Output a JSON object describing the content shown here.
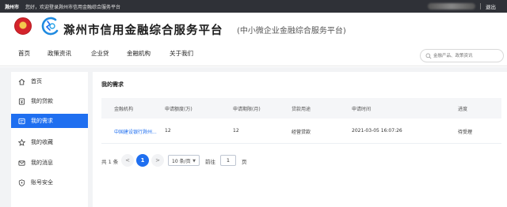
{
  "topbar": {
    "city": "滁州市",
    "welcome": "您好，欢迎登录滁州市信用金融综合服务平台",
    "logout_label": "退出"
  },
  "header": {
    "title": "滁州市信用金融综合服务平台",
    "subtitle": "(中小微企业金融综合服务平台)"
  },
  "nav": {
    "items": [
      "首页",
      "政策资讯",
      "企业贷",
      "金融机构",
      "关于我们"
    ],
    "search_placeholder": "金融产品、政策资讯"
  },
  "sidebar": {
    "items": [
      {
        "label": "首页",
        "icon": "home-icon"
      },
      {
        "label": "我的贷款",
        "icon": "loan-icon"
      },
      {
        "label": "我的需求",
        "icon": "demand-icon",
        "active": true
      },
      {
        "label": "我的收藏",
        "icon": "star-icon"
      },
      {
        "label": "我的消息",
        "icon": "message-icon"
      },
      {
        "label": "账号安全",
        "icon": "shield-icon"
      }
    ]
  },
  "content": {
    "title": "我的需求",
    "columns": [
      "金融机构",
      "申请额度(万)",
      "申请期限(月)",
      "贷款用途",
      "申请时间",
      "进度"
    ],
    "rows": [
      {
        "institution": "中国建设银行滁州...",
        "amount": "12",
        "term": "12",
        "purpose": "经营贷款",
        "time": "2021-03-05 16:07:26",
        "status": "待受理"
      }
    ]
  },
  "pagination": {
    "total": "共 1 条",
    "prev": "<",
    "current": "1",
    "next": ">",
    "page_size": "10 条/页",
    "goto_label": "前往",
    "goto_value": "1",
    "page_suffix": "页"
  },
  "colors": {
    "accent": "#1f6ff0",
    "topbar": "#2f3137",
    "background": "#f2f3f5"
  }
}
